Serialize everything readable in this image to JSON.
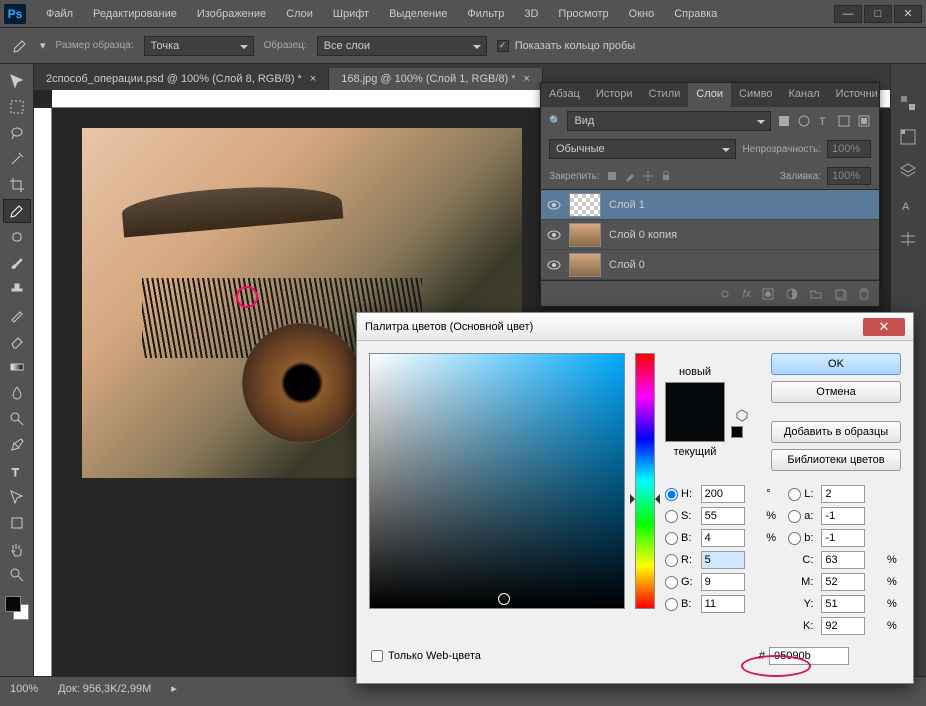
{
  "menu": {
    "items": [
      "Файл",
      "Редактирование",
      "Изображение",
      "Слои",
      "Шрифт",
      "Выделение",
      "Фильтр",
      "3D",
      "Просмотр",
      "Окно",
      "Справка"
    ]
  },
  "optbar": {
    "sample_size_label": "Размер образца:",
    "sample_size_value": "Точка",
    "sample_label": "Образец:",
    "sample_value": "Все слои",
    "show_ring": "Показать кольцо пробы"
  },
  "tabs": [
    {
      "label": "2способ_операции.psd @ 100% (Слой 8, RGB/8) *"
    },
    {
      "label": "168.jpg @ 100% (Слой 1, RGB/8) *"
    }
  ],
  "layers_panel": {
    "tabs": [
      "Абзац",
      "Истори",
      "Стили",
      "Слои",
      "Симво",
      "Канал",
      "Источни"
    ],
    "kind": "Вид",
    "blend": "Обычные",
    "opacity_label": "Непрозрачность:",
    "opacity": "100%",
    "lock_label": "Закрепить:",
    "fill_label": "Заливка:",
    "fill": "100%",
    "layers": [
      {
        "name": "Слой 1",
        "sel": true,
        "thumb": "checker"
      },
      {
        "name": "Слой 0 копия",
        "thumb": "eye"
      },
      {
        "name": "Слой 0",
        "thumb": "eye"
      }
    ]
  },
  "status": {
    "zoom": "100%",
    "doc": "Док: 956,3K/2,99M"
  },
  "color_picker": {
    "title": "Палитра цветов (Основной цвет)",
    "new_label": "новый",
    "current_label": "текущий",
    "ok": "OK",
    "cancel": "Отмена",
    "add": "Добавить в образцы",
    "libs": "Библиотеки цветов",
    "web_only": "Только Web-цвета",
    "H": "200",
    "S": "55",
    "B": "4",
    "R": "5",
    "G": "9",
    "Bl": "11",
    "L": "2",
    "a": "-1",
    "b": "-1",
    "C": "63",
    "M": "52",
    "Y": "51",
    "K": "92",
    "hex": "05090b"
  }
}
